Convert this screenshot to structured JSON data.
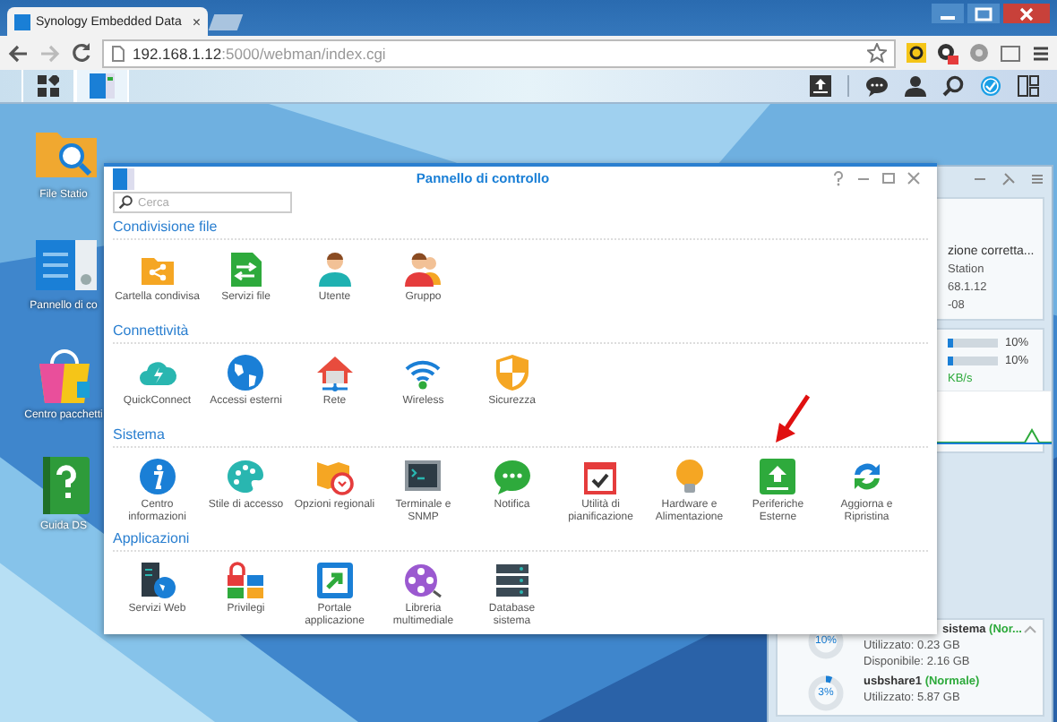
{
  "browser": {
    "tab_title": "Synology Embedded Data",
    "tab_close": "×",
    "address_host": "192.168.1.12",
    "address_rest": ":5000/webman/index.cgi"
  },
  "desktop_icons": [
    {
      "label": "File Statio"
    },
    {
      "label": "Pannello di co"
    },
    {
      "label": "Centro pacchetti"
    },
    {
      "label": "Guida DS"
    }
  ],
  "taskbar": {
    "control_panel_open": true
  },
  "window": {
    "title": "Pannello di controllo",
    "search": {
      "placeholder": "Cerca"
    },
    "sections": [
      {
        "title": "Condivisione file",
        "items": [
          {
            "label": "Cartella condivisa"
          },
          {
            "label": "Servizi file"
          },
          {
            "label": "Utente"
          },
          {
            "label": "Gruppo"
          }
        ]
      },
      {
        "title": "Connettività",
        "items": [
          {
            "label": "QuickConnect"
          },
          {
            "label": "Accessi esterni"
          },
          {
            "label": "Rete"
          },
          {
            "label": "Wireless"
          },
          {
            "label": "Sicurezza"
          }
        ]
      },
      {
        "title": "Sistema",
        "items": [
          {
            "label": "Centro informazioni"
          },
          {
            "label": "Stile di accesso"
          },
          {
            "label": "Opzioni regionali"
          },
          {
            "label": "Terminale e SNMP"
          },
          {
            "label": "Notifica"
          },
          {
            "label": "Utilità di pianificazione"
          },
          {
            "label": "Hardware e Alimentazione"
          },
          {
            "label": "Periferiche Esterne"
          },
          {
            "label": "Aggiorna e Ripristina"
          }
        ]
      },
      {
        "title": "Applicazioni",
        "items": [
          {
            "label": "Servizi Web"
          },
          {
            "label": "Privilegi"
          },
          {
            "label": "Portale applicazione"
          },
          {
            "label": "Libreria multimediale"
          },
          {
            "label": "Database sistema"
          }
        ]
      }
    ]
  },
  "widgets": {
    "health": {
      "status": "zione corretta...",
      "lines": [
        "Station",
        "68.1.12",
        "-08"
      ]
    },
    "resources": {
      "meters": [
        {
          "reading": "10%",
          "level": 0.1
        },
        {
          "reading": "10%",
          "level": 0.1
        }
      ],
      "speed": "KB/s"
    },
    "storage": [
      {
        "percent": "10%",
        "name": "sistema",
        "status": "(Nor...",
        "used": "Utilizzato: 0.23 GB",
        "free": "Disponibile: 2.16 GB"
      },
      {
        "percent": "3%",
        "name": "usbshare1",
        "status": "(Normale)",
        "used": "Utilizzato: 5.87 GB"
      }
    ]
  }
}
